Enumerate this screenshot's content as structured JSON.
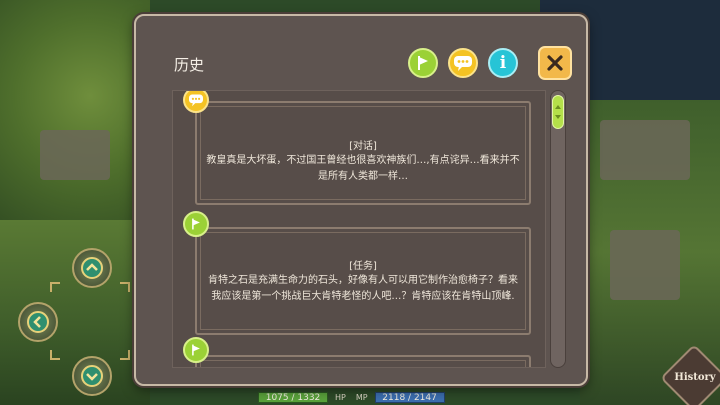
{
  "dialog": {
    "title": "历史",
    "icons": {
      "task": "task-flag-icon",
      "chat": "speech-bubble-icon",
      "info": "info-icon",
      "close": "close-icon"
    },
    "info_glyph": "i"
  },
  "entries": [
    {
      "type_icon": "speech-bubble-icon",
      "tag": "[对话]",
      "text": "教皇真是大坏蛋，不过国王曾经也很喜欢神族们…,有点诧异…看来并不是所有人类都一样…"
    },
    {
      "type_icon": "task-flag-icon",
      "tag": "[任务]",
      "text": "肯特之石是充满生命力的石头，好像有人可以用它制作治愈椅子？看来我应该是第一个挑战巨大肯特老怪的人吧…？肯特应该在肯特山顶峰."
    },
    {
      "type_icon": "task-flag-icon",
      "tag": "",
      "text": ""
    }
  ],
  "hud": {
    "history_label": "History",
    "hp_value": "1075 / 1332",
    "hp_tag": "HP",
    "mp_tag": "MP",
    "mp_value": "2118 / 2147"
  },
  "colors": {
    "dialog_bg": "#5e5450",
    "task_green": "#9bd136",
    "chat_yellow": "#f4c324",
    "info_cyan": "#27c4d6",
    "close_orange": "#f2b84a"
  }
}
